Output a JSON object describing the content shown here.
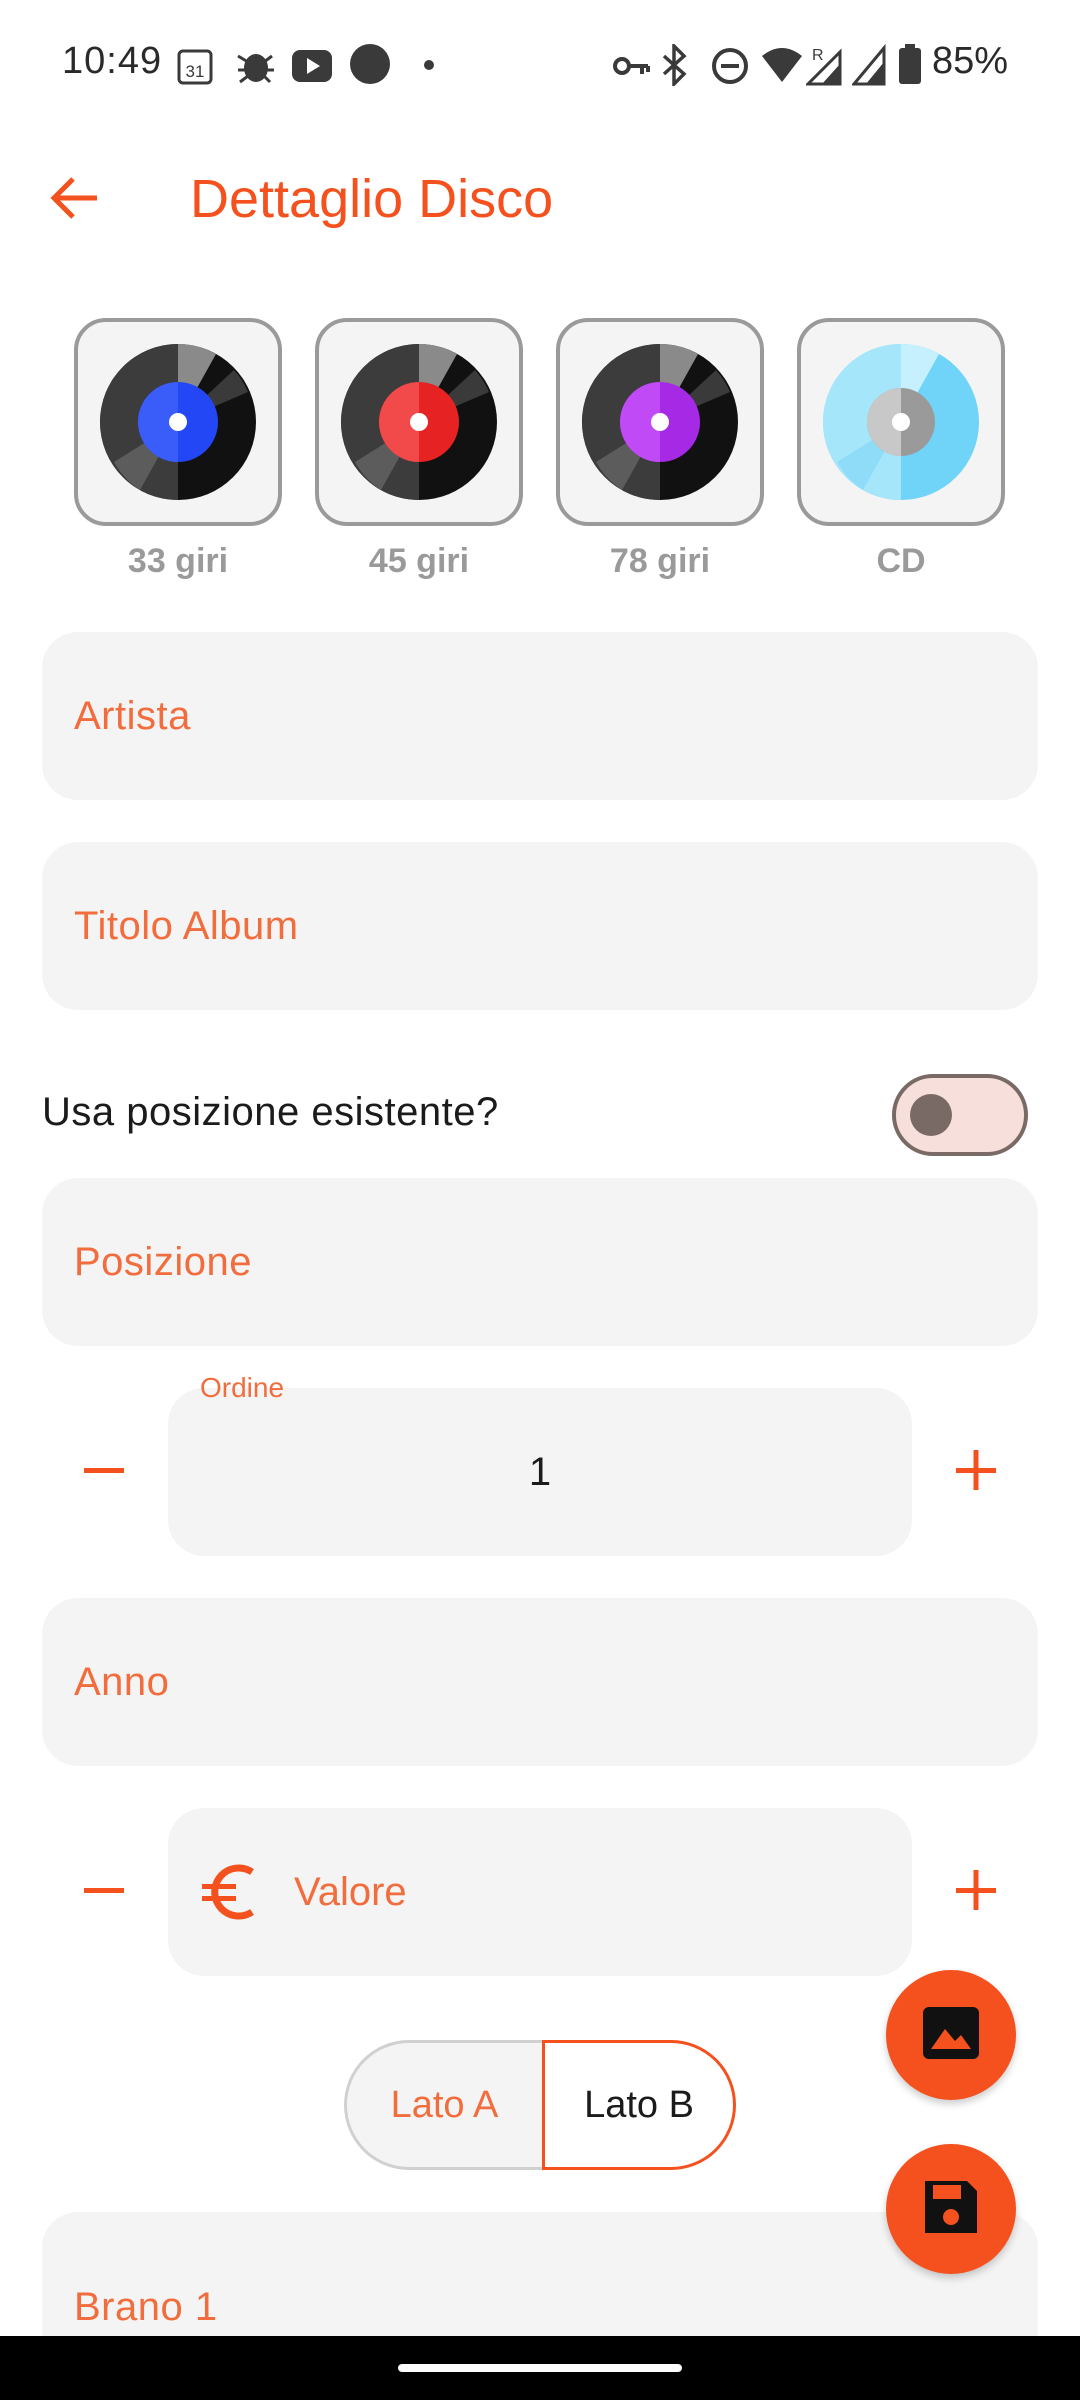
{
  "status_bar": {
    "time": "10:49",
    "battery": "85%",
    "calendar_day": "31",
    "icons": [
      "calendar-icon",
      "bug-icon",
      "youtube-icon",
      "circle-icon",
      "dot-icon",
      "vpn-key-icon",
      "bluetooth-icon",
      "dnd-icon",
      "wifi-icon",
      "signal-roaming-icon",
      "signal-icon",
      "battery-icon"
    ]
  },
  "app_bar": {
    "title": "Dettaglio Disco",
    "back_icon": "arrow-back-icon"
  },
  "formats": [
    {
      "label": "33 giri",
      "center_color": "#2347f5"
    },
    {
      "label": "45 giri",
      "center_color": "#f02b2b"
    },
    {
      "label": "78 giri",
      "center_color": "#b62ff0"
    },
    {
      "label": "CD",
      "center_color": "#bdbdbd"
    }
  ],
  "fields": {
    "artist": "Artista",
    "album_title": "Titolo Album",
    "position": "Posizione",
    "year": "Anno",
    "track_1": "Brano 1"
  },
  "switch": {
    "label": "Usa posizione esistente?",
    "checked": false
  },
  "order": {
    "label": "Ordine",
    "value": "1"
  },
  "value_field": {
    "label": "Valore",
    "icon": "euro-icon"
  },
  "sides": {
    "a": "Lato A",
    "b": "Lato B",
    "selected": "Lato B"
  },
  "fabs": {
    "image_icon": "image-icon",
    "save_icon": "save-icon"
  },
  "colors": {
    "accent": "#f4511e",
    "label": "#f26d3d",
    "field_bg": "#f4f4f4"
  }
}
